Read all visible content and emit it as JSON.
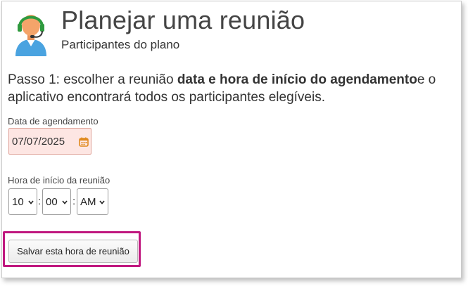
{
  "header": {
    "title": "Planejar uma reunião",
    "subtitle": "Participantes do plano",
    "avatar_icon": "support-agent-icon"
  },
  "step": {
    "prefix": "Passo 1: escolher a reunião ",
    "bold": "data e hora de início do agendamento",
    "suffix": "e o aplicativo encontrará todos os participantes elegíveis."
  },
  "date_field": {
    "label": "Data de agendamento",
    "value": "07/07/2025",
    "icon": "calendar-icon"
  },
  "time_field": {
    "label": "Hora de início da reunião",
    "hour": "10",
    "minute": "00",
    "ampm": "AM",
    "separator": ":"
  },
  "save_button": {
    "label": "Salvar esta hora de reunião"
  },
  "colors": {
    "highlight": "#c0187f",
    "date_bg": "#fde6e3",
    "calendar": "#e08a1e",
    "avatar_skin": "#f4a46a",
    "avatar_body": "#4aa3e0"
  }
}
